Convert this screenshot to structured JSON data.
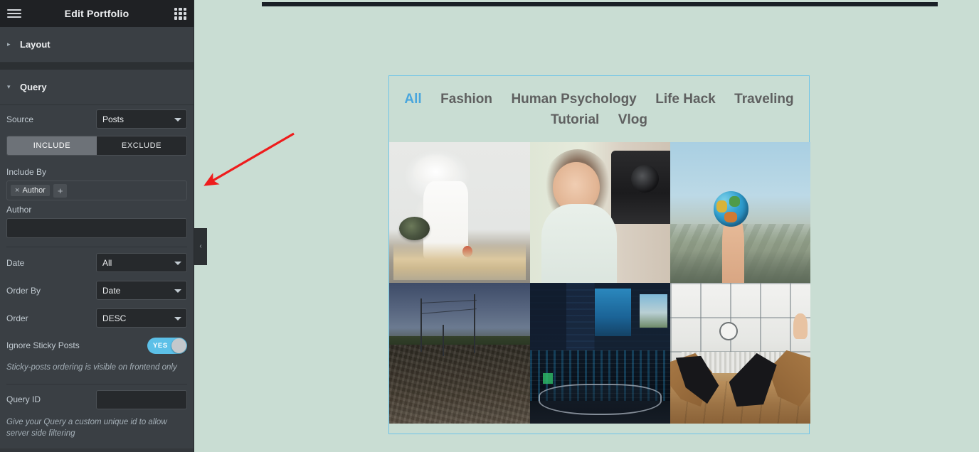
{
  "panel": {
    "title": "Edit Portfolio",
    "menu_icon": "hamburger-menu-icon",
    "widgets_icon": "grid-widgets-icon",
    "sections": [
      {
        "id": "layout",
        "label": "Layout",
        "caret": "▸",
        "expanded": false
      },
      {
        "id": "query",
        "label": "Query",
        "caret": "▾",
        "expanded": true
      }
    ],
    "query": {
      "source": {
        "label": "Source",
        "value": "Posts"
      },
      "segmented": {
        "include": "INCLUDE",
        "exclude": "EXCLUDE",
        "selected": "INCLUDE"
      },
      "include_by": {
        "label": "Include By",
        "tags": [
          {
            "label": "Author",
            "remove": "×"
          }
        ],
        "add": "+"
      },
      "author": {
        "label": "Author",
        "value": ""
      },
      "date": {
        "label": "Date",
        "value": "All"
      },
      "order_by": {
        "label": "Order By",
        "value": "Date"
      },
      "order": {
        "label": "Order",
        "value": "DESC"
      },
      "ignore_sticky": {
        "label": "Ignore Sticky Posts",
        "toggle_text": "YES",
        "toggle_on": true,
        "hint": "Sticky-posts ordering is visible on frontend only"
      },
      "query_id": {
        "label": "Query ID",
        "value": "",
        "hint": "Give your Query a custom unique id to allow server side filtering"
      }
    }
  },
  "collapse_handle": {
    "icon": "chevron-left-icon",
    "label": "‹"
  },
  "preview": {
    "filters": [
      {
        "label": "All",
        "active": true
      },
      {
        "label": "Fashion",
        "active": false
      },
      {
        "label": "Human Psychology",
        "active": false
      },
      {
        "label": "Life Hack",
        "active": false
      },
      {
        "label": "Traveling",
        "active": false
      },
      {
        "label": "Tutorial",
        "active": false
      },
      {
        "label": "Vlog",
        "active": false
      }
    ],
    "active_filter_color": "#49a6dd",
    "filter_color": "#5f6060",
    "selection_border_color": "#6fc4e8",
    "background_color": "#c9ddd3",
    "items": [
      {
        "alt": "Chef in white uniform plating food in tiled kitchen"
      },
      {
        "alt": "Woman speaking in front of a video camera"
      },
      {
        "alt": "Hand holding a small globe in front of mountains"
      },
      {
        "alt": "Gravel road at dusk with power line poles"
      },
      {
        "alt": "Video editing workstation with dark blue screens"
      },
      {
        "alt": "Two people reclining in chairs by a bright window with a clock"
      }
    ]
  },
  "annotation": {
    "type": "red-arrow",
    "color": "#ee1c1c"
  }
}
